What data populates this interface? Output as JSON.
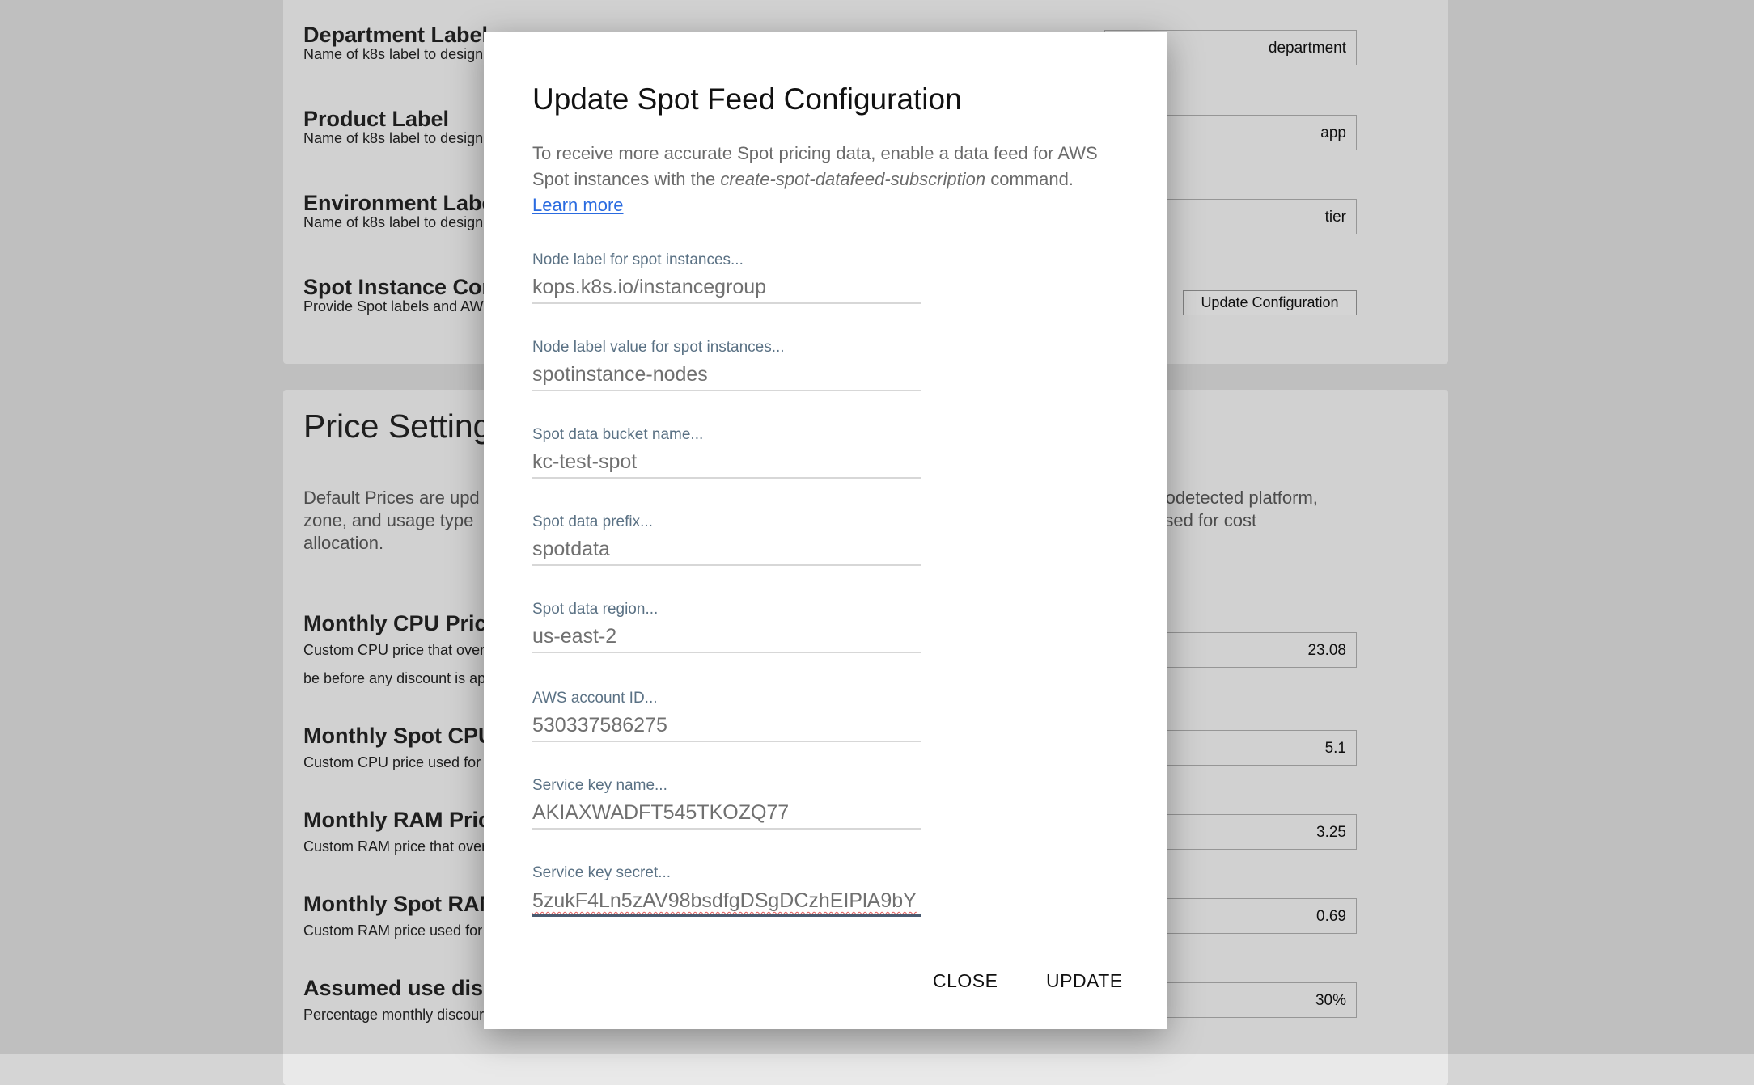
{
  "general": {
    "settings": [
      {
        "title": "Department Label",
        "desc": "Name of k8s label to design",
        "value": "department"
      },
      {
        "title": "Product Label",
        "desc": "Name of k8s label to design",
        "value": "app"
      },
      {
        "title": "Environment Labe",
        "desc": "Name of k8s label to design",
        "value": "tier"
      },
      {
        "title": "Spot Instance Con",
        "desc": "Provide Spot labels and AW",
        "button": "Update Configuration"
      }
    ]
  },
  "price": {
    "title": "Price Settings",
    "intro_left": "Default Prices are upd\nzone, and usage type \nallocation.",
    "intro_right": "autodetected platform,\ns used for cost",
    "settings": [
      {
        "title": "Monthly CPU Price",
        "desc": "Custom CPU price that over",
        "desc2": "be before any discount is ap",
        "value": "23.08"
      },
      {
        "title": "Monthly Spot CPU",
        "desc": "Custom CPU price used for",
        "value": "5.1"
      },
      {
        "title": "Monthly RAM Pric",
        "desc": "Custom RAM price that over",
        "value": "3.25"
      },
      {
        "title": "Monthly Spot RAM",
        "desc": "Custom RAM price used for",
        "value": "0.69"
      },
      {
        "title": "Assumed use disc",
        "desc": "Percentage monthly discour",
        "value": "30%"
      }
    ]
  },
  "dialog": {
    "title": "Update Spot Feed Configuration",
    "desc_before": "To receive more accurate Spot pricing data, enable a data feed for AWS Spot instances with the ",
    "desc_command": "create-spot-datafeed-subscription",
    "desc_after": " command.",
    "learn_more": "Learn more",
    "fields": [
      {
        "label": "Node label for spot instances...",
        "value": "kops.k8s.io/instancegroup"
      },
      {
        "label": "Node label value for spot instances...",
        "value": "spotinstance-nodes"
      },
      {
        "label": "Spot data bucket name...",
        "value": "kc-test-spot"
      },
      {
        "label": "Spot data prefix...",
        "value": "spotdata"
      },
      {
        "label": "Spot data region...",
        "value": "us-east-2"
      },
      {
        "label": "AWS account ID...",
        "value": "530337586275"
      },
      {
        "label": "Service key name...",
        "value": "AKIAXWADFT545TKOZQ77"
      },
      {
        "label": "Service key secret...",
        "value": "5zukF4Ln5zAV98bsdfgDSgDCzhEIPlA9bY"
      }
    ],
    "close_label": "CLOSE",
    "update_label": "UPDATE"
  }
}
